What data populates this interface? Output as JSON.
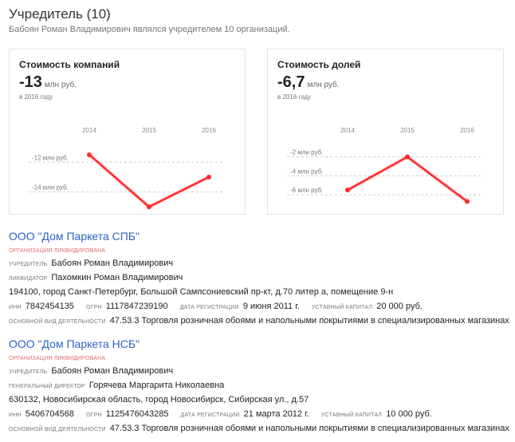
{
  "header": {
    "title": "Учредитель (10)",
    "subtitle": "Бабоян Роман Владимирович являлся учредителем 10 организаций."
  },
  "cards": [
    {
      "title": "Стоимость компаний",
      "value": "-13",
      "unit": "млн руб.",
      "period": "в 2016 году"
    },
    {
      "title": "Стоимость долей",
      "value": "-6,7",
      "unit": "млн руб.",
      "period": "в 2016 году"
    }
  ],
  "chart_data": [
    {
      "type": "line",
      "x": [
        "2014",
        "2015",
        "2016"
      ],
      "y_ticks": [
        "-12 млн руб.",
        "-14 млн руб."
      ],
      "y_tick_values": [
        -12,
        -14
      ],
      "ylim": [
        -15.15,
        -10.75
      ],
      "series": [
        {
          "values": [
            -11.5,
            -15.0,
            -13.0
          ]
        }
      ],
      "line_color": "#ff2a2a"
    },
    {
      "type": "line",
      "x": [
        "2014",
        "2015",
        "2016"
      ],
      "y_ticks": [
        "-2 млн руб.",
        "-4 млн руб.",
        "-6 млн руб."
      ],
      "y_tick_values": [
        -2,
        -4,
        -6
      ],
      "ylim": [
        -7.5,
        -0.6
      ],
      "series": [
        {
          "values": [
            -5.5,
            -2.0,
            -6.7
          ]
        }
      ],
      "line_color": "#ff2a2a"
    }
  ],
  "orgs": [
    {
      "name": "ООО \"Дом Паркета СПБ\"",
      "status": "организация ликвидирована",
      "founder_label": "учредитель",
      "founder": "Бабоян Роман Владимирович",
      "manager_label": "ликвидатор",
      "manager": "Пахомкин Роман Владимирович",
      "address": "194100, город Санкт-Петербург, Большой Сампсониевский пр-кт, д.70 литер а, помещение 9-н",
      "inn_label": "ИНН",
      "inn": "7842454135",
      "ogrn_label": "ОГРН",
      "ogrn": "1117847239190",
      "reg_label": "дата регистрации",
      "reg_date": "9 июня 2011 г.",
      "capital_label": "уставный капитал",
      "capital": "20 000 руб.",
      "activity_label": "основной вид деятельности",
      "activity": "47.53.3 Торговля розничная обоями и напольными покрытиями в специализированных магазинах"
    },
    {
      "name": "ООО \"Дом Паркета НСБ\"",
      "status": "организация ликвидирована",
      "founder_label": "учредитель",
      "founder": "Бабоян Роман Владимирович",
      "manager_label": "генеральный директор",
      "manager": "Горячева Маргарита Николаевна",
      "address": "630132, Новосибирская область, город Новосибирск, Сибирская ул., д.57",
      "inn_label": "ИНН",
      "inn": "5406704568",
      "ogrn_label": "ОГРН",
      "ogrn": "1125476043285",
      "reg_label": "дата регистрации",
      "reg_date": "21 марта 2012 г.",
      "capital_label": "уставный капитал",
      "capital": "10 000 руб.",
      "activity_label": "основной вид деятельности",
      "activity": "47.53.3 Торговля розничная обоями и напольными покрытиями в специализированных магазинах"
    }
  ]
}
